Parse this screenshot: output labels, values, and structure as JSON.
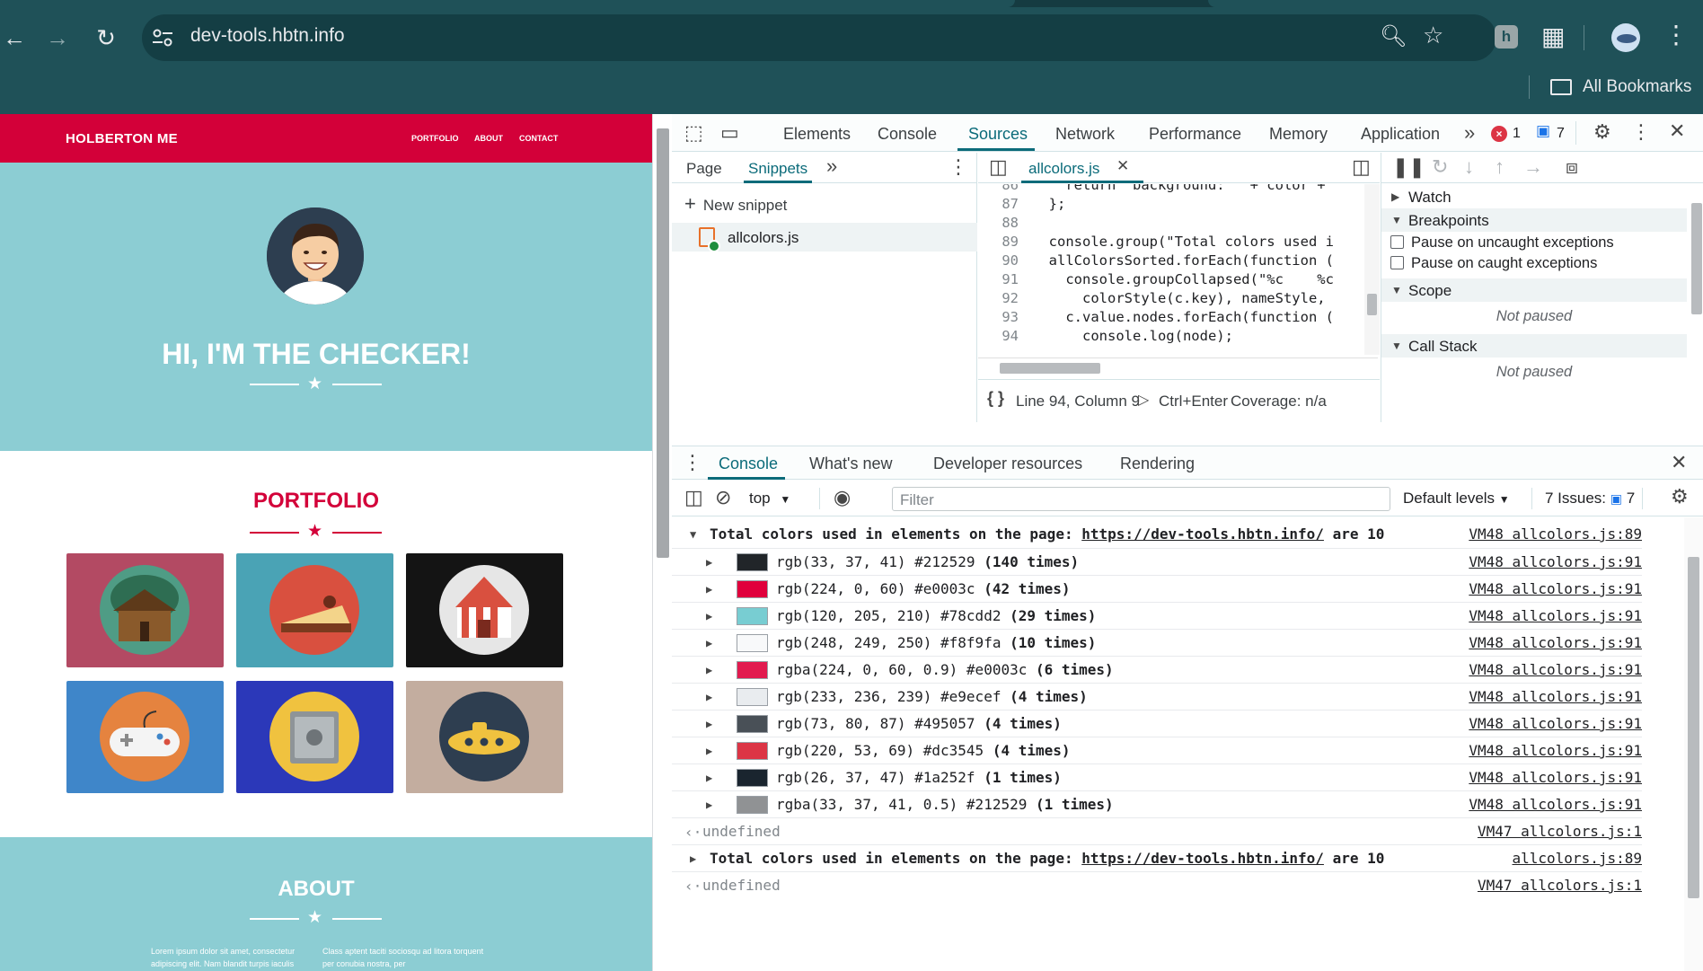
{
  "browser": {
    "url": "dev-tools.hbtn.info",
    "extension_badge": "h",
    "bookmarks_label": "All Bookmarks",
    "icons": [
      "back-icon",
      "forward-icon",
      "reload-icon",
      "tune-icon",
      "zoom-icon",
      "star-icon",
      "extensions-icon",
      "profile-avatar",
      "more-vert-icon",
      "folder-icon"
    ]
  },
  "site": {
    "brand": "HOLBERTON ME",
    "nav_links": [
      "PORTFOLIO",
      "ABOUT",
      "CONTACT"
    ],
    "hero_title": "HI, I'M THE CHECKER!",
    "portfolio_title": "PORTFOLIO",
    "about_title": "ABOUT",
    "about_col1": "Lorem ipsum dolor sit amet, consectetur adipiscing elit. Nam blandit turpis iaculis",
    "about_col2": "Class aptent taciti sociosqu ad litora torquent per conubia nostra, per",
    "colors": {
      "red": "#d30039",
      "teal": "#8ccdd3"
    }
  },
  "devtools": {
    "tabs": [
      "Elements",
      "Console",
      "Sources",
      "Network",
      "Performance",
      "Memory",
      "Application"
    ],
    "active_tab": "Sources",
    "error_count": "1",
    "message_count": "7",
    "sources": {
      "subtabs": [
        "Page",
        "Snippets"
      ],
      "active_subtab": "Snippets",
      "new_snippet": "New snippet",
      "snippet_file": "allcolors.js",
      "open_file": "allcolors.js",
      "code_lines": [
        {
          "ln": "86",
          "code": "    return 'background: ' + color +"
        },
        {
          "ln": "87",
          "code": "  };"
        },
        {
          "ln": "88",
          "code": ""
        },
        {
          "ln": "89",
          "code": "  console.group(\"Total colors used i"
        },
        {
          "ln": "90",
          "code": "  allColorsSorted.forEach(function ("
        },
        {
          "ln": "91",
          "code": "    console.groupCollapsed(\"%c    %c"
        },
        {
          "ln": "92",
          "code": "      colorStyle(c.key), nameStyle,"
        },
        {
          "ln": "93",
          "code": "    c.value.nodes.forEach(function ("
        },
        {
          "ln": "94",
          "code": "      console.log(node);"
        }
      ],
      "status_position": "Line 94, Column 9",
      "status_run": "Ctrl+Enter",
      "status_coverage": "Coverage: n/a"
    },
    "debugger": {
      "watch": "Watch",
      "breakpoints": "Breakpoints",
      "pause_uncaught": "Pause on uncaught exceptions",
      "pause_caught": "Pause on caught exceptions",
      "scope": "Scope",
      "scope_status": "Not paused",
      "callstack": "Call Stack",
      "callstack_status": "Not paused"
    },
    "drawer": {
      "tabs": [
        "Console",
        "What's new",
        "Developer resources",
        "Rendering"
      ],
      "active_tab": "Console",
      "context": "top",
      "filter_placeholder": "Filter",
      "levels": "Default levels",
      "issues_label": "7 Issues:",
      "issues_count": "7"
    },
    "console": {
      "group_header": {
        "prefix": "Total colors used in elements on the page: ",
        "url": "https://dev-tools.hbtn.info/",
        "suffix": " are 10",
        "source": "VM48 allcolors.js:89"
      },
      "color_rows": [
        {
          "swatch": "#212529",
          "label": "rgb(33, 37, 41) #212529 ",
          "count": "(140 times)",
          "source": "VM48 allcolors.js:91"
        },
        {
          "swatch": "#e0003c",
          "label": "rgb(224, 0, 60) #e0003c ",
          "count": "(42 times)",
          "source": "VM48 allcolors.js:91"
        },
        {
          "swatch": "#78cdd2",
          "label": "rgb(120, 205, 210) #78cdd2 ",
          "count": "(29 times)",
          "source": "VM48 allcolors.js:91"
        },
        {
          "swatch": "#f8f9fa",
          "label": "rgb(248, 249, 250) #f8f9fa ",
          "count": "(10 times)",
          "source": "VM48 allcolors.js:91"
        },
        {
          "swatch": "#e21a4f",
          "label": "rgba(224, 0, 60, 0.9) #e0003c ",
          "count": "(6 times)",
          "source": "VM48 allcolors.js:91"
        },
        {
          "swatch": "#e9ecef",
          "label": "rgb(233, 236, 239) #e9ecef ",
          "count": "(4 times)",
          "source": "VM48 allcolors.js:91"
        },
        {
          "swatch": "#495057",
          "label": "rgb(73, 80, 87) #495057 ",
          "count": "(4 times)",
          "source": "VM48 allcolors.js:91"
        },
        {
          "swatch": "#dc3545",
          "label": "rgb(220, 53, 69) #dc3545 ",
          "count": "(4 times)",
          "source": "VM48 allcolors.js:91"
        },
        {
          "swatch": "#1a252f",
          "label": "rgb(26, 37, 47) #1a252f ",
          "count": "(1 times)",
          "source": "VM48 allcolors.js:91"
        },
        {
          "swatch": "#909294",
          "label": "rgba(33, 37, 41, 0.5) #212529 ",
          "count": "(1 times)",
          "source": "VM48 allcolors.js:91"
        }
      ],
      "undefined_1": {
        "text": "undefined",
        "source": "VM47 allcolors.js:1"
      },
      "group_header_2": {
        "prefix": "Total colors used in elements on the page: ",
        "url": "https://dev-tools.hbtn.info/",
        "suffix": " are 10",
        "source": "allcolors.js:89"
      },
      "undefined_2": {
        "text": "undefined",
        "source": "VM47 allcolors.js:1"
      }
    }
  }
}
